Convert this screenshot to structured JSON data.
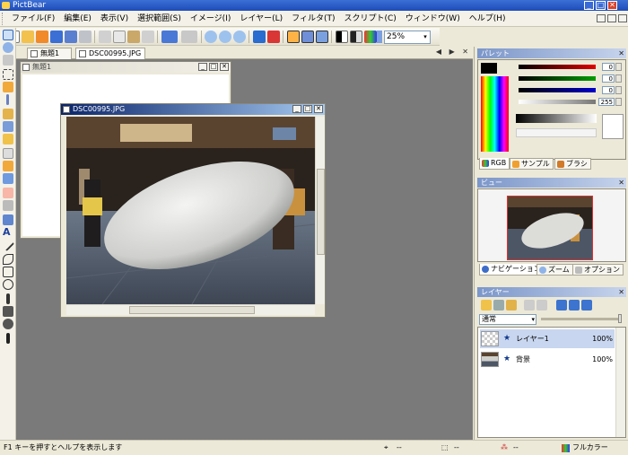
{
  "app": {
    "title": "PictBear"
  },
  "menu": [
    "ファイル(F)",
    "編集(E)",
    "表示(V)",
    "選択範囲(S)",
    "イメージ(I)",
    "レイヤー(L)",
    "フィルタ(T)",
    "スクリプト(C)",
    "ウィンドウ(W)",
    "ヘルプ(H)"
  ],
  "toolbar": {
    "zoom_value": "25%",
    "zoom_arrow": "▾"
  },
  "tabs": [
    {
      "label": "無題1"
    },
    {
      "label": "DSC00995.JPG"
    }
  ],
  "tab_arrows": "◀ ▶ ✕",
  "windows": {
    "untitled": {
      "title": "無題1"
    },
    "photo": {
      "title": "DSC00995.JPG"
    }
  },
  "window_controls": {
    "minimize": "_",
    "maximize": "□",
    "close": "✕"
  },
  "palette": {
    "title": "パレット",
    "values": [
      "0",
      "0",
      "0",
      "255"
    ],
    "tabs": [
      "RGB",
      "サンプル",
      "ブラシ"
    ]
  },
  "view": {
    "title": "ビュー",
    "tabs": [
      "ナビゲーション",
      "ズーム",
      "オプション"
    ]
  },
  "layers": {
    "title": "レイヤー",
    "blend_mode": "通常",
    "items": [
      {
        "name": "レイヤー1",
        "opacity": "100%",
        "selected": true
      },
      {
        "name": "背景",
        "opacity": "100%",
        "selected": false
      }
    ]
  },
  "statusbar": {
    "help": "F1 キーを押すとヘルプを表示します",
    "pos": "--",
    "size": "--",
    "color": "--",
    "mode": "フルカラー"
  },
  "colors": {
    "title_active": "#0a246a",
    "workspace": "#7a7a7a",
    "red": "#e00000",
    "green": "#009c00",
    "blue": "#0000c8"
  }
}
